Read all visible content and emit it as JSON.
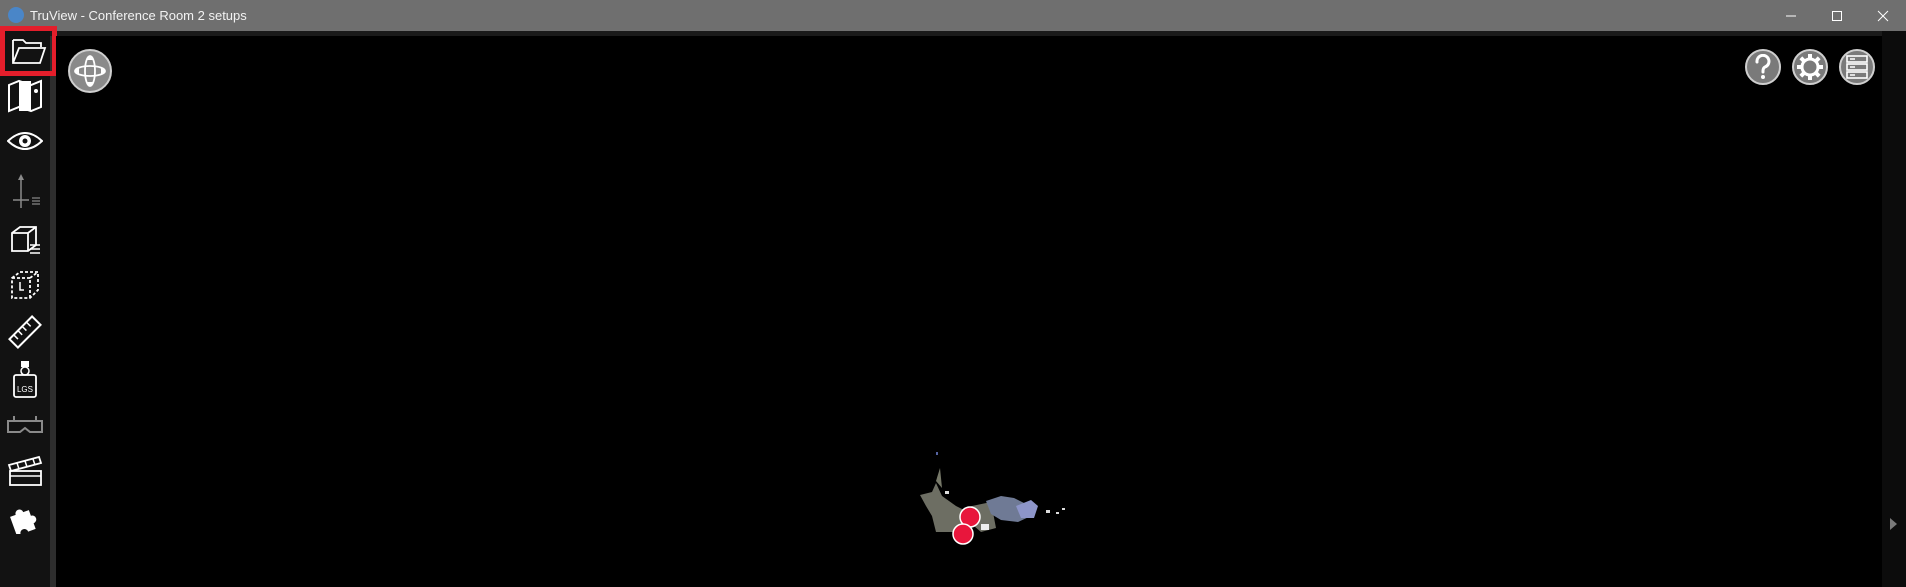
{
  "window": {
    "title": "TruView - Conference Room 2 setups",
    "app_icon": "truview-logo-icon",
    "controls": [
      "minimize-icon",
      "maximize-icon",
      "close-icon"
    ]
  },
  "sidebar": {
    "items": [
      {
        "name": "open-folder-icon",
        "active": true
      },
      {
        "name": "map-icon"
      },
      {
        "name": "eye-icon"
      },
      {
        "name": "axis-icon"
      },
      {
        "name": "cube-list-icon"
      },
      {
        "name": "clip-box-icon"
      },
      {
        "name": "ruler-icon"
      },
      {
        "name": "lgs-bottle-icon",
        "label": "LGS"
      },
      {
        "name": "vr-headset-icon"
      },
      {
        "name": "clapperboard-icon"
      },
      {
        "name": "puzzle-icon"
      }
    ]
  },
  "viewport": {
    "nav_button": "navigation-compass-icon",
    "top_right_buttons": [
      "help-icon",
      "settings-gear-icon",
      "layers-server-icon"
    ],
    "expand_arrow": "chevron-right-icon"
  },
  "colors": {
    "titlebar": "#6f6f6f",
    "sidebar": "#121212",
    "active_highlight": "#e41e2b",
    "setup_marker": "#e8163c"
  }
}
